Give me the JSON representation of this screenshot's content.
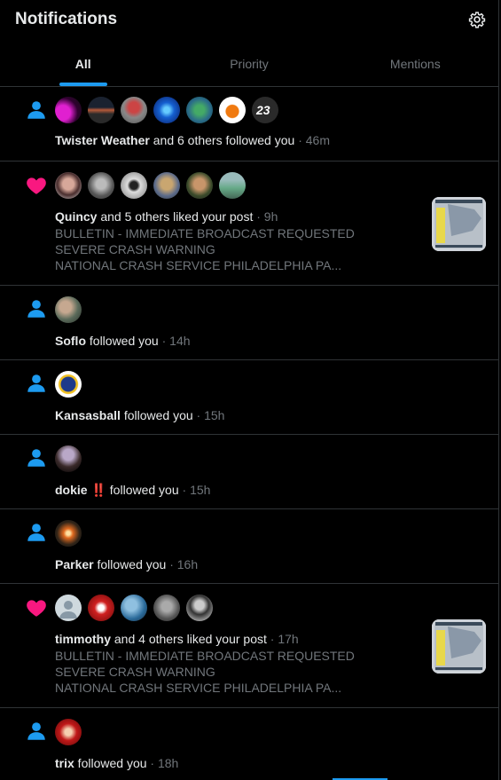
{
  "header": {
    "title": "Notifications",
    "settings_icon": "gear-icon"
  },
  "tabs": [
    {
      "label": "All",
      "active": true
    },
    {
      "label": "Priority",
      "active": false
    },
    {
      "label": "Mentions",
      "active": false
    }
  ],
  "notifications": [
    {
      "type": "follow",
      "name": "Twister Weather",
      "rest": " and 6 others followed you",
      "time": " · 46m"
    },
    {
      "type": "like",
      "name": "Quincy",
      "rest": " and 5 others liked your post",
      "time": " · 9h",
      "preview": [
        "BULLETIN - IMMEDIATE BROADCAST REQUESTED",
        "SEVERE CRASH WARNING",
        "NATIONAL CRASH SERVICE PHILADELPHIA PA..."
      ]
    },
    {
      "type": "follow",
      "name": "Soflo",
      "rest": " followed you",
      "time": " · 14h"
    },
    {
      "type": "follow",
      "name": "Kansasball",
      "rest": " followed you",
      "time": " · 15h"
    },
    {
      "type": "follow",
      "name": "dokie",
      "emoji": " ‼️",
      "rest": " followed you",
      "time": " · 15h"
    },
    {
      "type": "follow",
      "name": "Parker",
      "rest": " followed you",
      "time": " · 16h"
    },
    {
      "type": "like",
      "name": "timmothy",
      "rest": " and 4 others liked your post",
      "time": " · 17h",
      "preview": [
        "BULLETIN - IMMEDIATE BROADCAST REQUESTED",
        "SEVERE CRASH WARNING",
        "NATIONAL CRASH SERVICE PHILADELPHIA PA..."
      ]
    },
    {
      "type": "follow",
      "name": "trix",
      "rest": " followed you",
      "time": " · 18h"
    }
  ],
  "colors": {
    "accent": "#1d9bf0",
    "like": "#f91880",
    "muted": "#71767b",
    "border": "#2f3336"
  }
}
